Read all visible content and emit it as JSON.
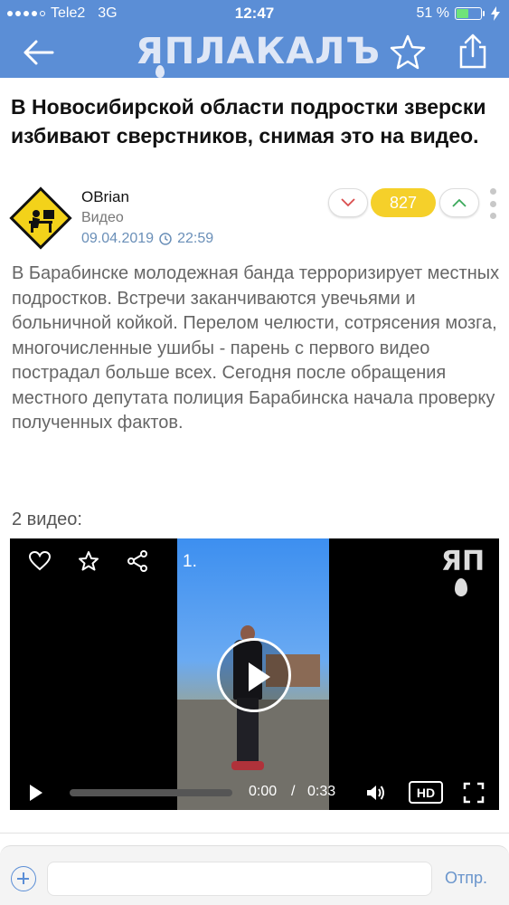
{
  "status_bar": {
    "carrier": "Tele2",
    "network": "3G",
    "time": "12:47",
    "battery_percent_text": "51 %",
    "battery_level": 0.51
  },
  "nav": {
    "logo_text": "ЯПЛАКАЛЪ",
    "back_icon": "arrow-left-icon",
    "favorite_icon": "star-outline-icon",
    "share_icon": "share-upload-icon",
    "bar_color": "#5b8ed6"
  },
  "post": {
    "title": "В Новосибирской области подростки зверски избивают сверстников, снимая это на видео.",
    "author": "OBrian",
    "category": "Видео",
    "date": "09.04.2019",
    "time": "22:59",
    "rating": "827",
    "body": "В Барабинске молодежная банда терроризирует местных подростков. Встречи заканчиваются увечьями и больничной койкой. Перелом челюсти, сотрясения мозга, многочисленные ушибы - парень с первого видео пострадал больше всех. Сегодня после обращения местного депутата полиция Барабинска начала проверку полученных фактов.",
    "video_count": "2 видео:"
  },
  "video": {
    "index_label": "1.",
    "watermark": "ЯП",
    "current_time": "0:00",
    "separator": "/",
    "total_time": "0:33",
    "quality_label": "HD",
    "progress": 0.0
  },
  "composer": {
    "placeholder": "",
    "send_label": "Отпр."
  },
  "colors": {
    "accent": "#5b8ed6",
    "rating_bg": "#f5d02a",
    "date_color": "#6a8fb8"
  }
}
